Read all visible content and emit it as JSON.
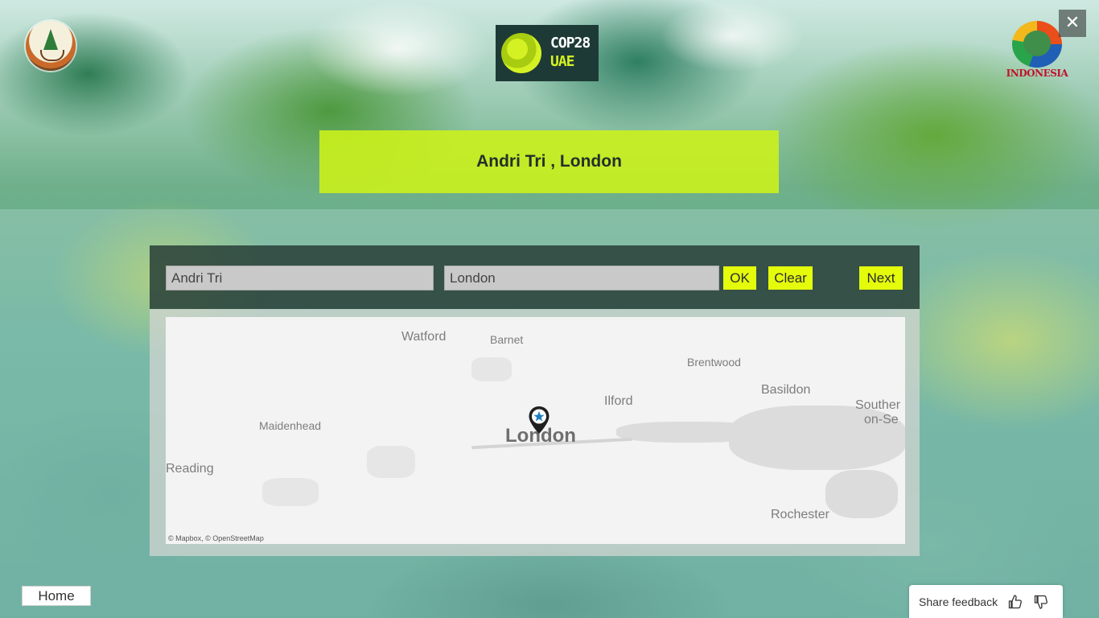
{
  "header": {
    "title": "Andri Tri , London",
    "cop_logo_line1": "COP28",
    "cop_logo_line2": "UAE",
    "right_logo_text": "INDONESIA"
  },
  "form": {
    "name_value": "Andri Tri",
    "city_value": "London",
    "ok_label": "OK",
    "clear_label": "Clear",
    "next_label": "Next"
  },
  "map": {
    "labels": {
      "watford": "Watford",
      "barnet": "Barnet",
      "brentwood": "Brentwood",
      "ilford": "Ilford",
      "basildon": "Basildon",
      "southend_1": "Souther",
      "southend_2": "on-Se",
      "maidenhead": "Maidenhead",
      "london": "London",
      "reading": "Reading",
      "rochester": "Rochester"
    },
    "attribution": "© Mapbox, © OpenStreetMap",
    "marker_icon": "star-pin-icon"
  },
  "footer": {
    "home_label": "Home",
    "feedback_label": "Share feedback"
  },
  "colors": {
    "accent": "#e4fb0c",
    "banner": "#cdf219",
    "panel": "#283e37"
  }
}
